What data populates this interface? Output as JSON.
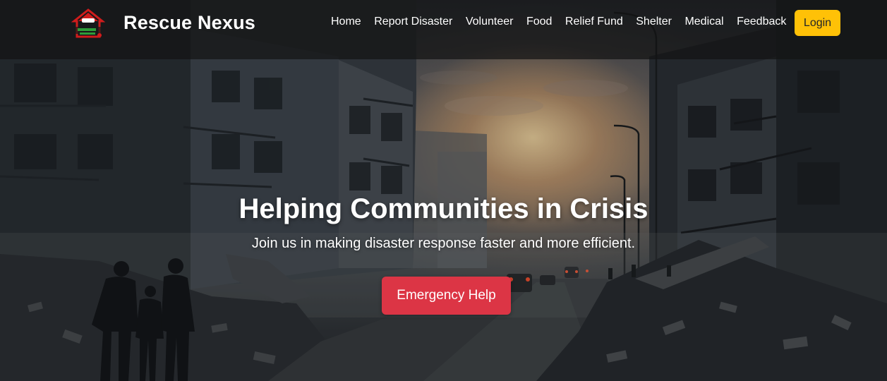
{
  "header": {
    "brand": "Rescue Nexus",
    "logo_icon": "house-shield-icon",
    "nav": [
      {
        "label": "Home"
      },
      {
        "label": "Report Disaster"
      },
      {
        "label": "Volunteer"
      },
      {
        "label": "Food"
      },
      {
        "label": "Relief Fund"
      },
      {
        "label": "Shelter"
      },
      {
        "label": "Medical"
      },
      {
        "label": "Feedback"
      }
    ],
    "login_label": "Login"
  },
  "hero": {
    "title": "Helping Communities in Crisis",
    "subtitle": "Join us in making disaster response faster and more efficient.",
    "cta_label": "Emergency Help",
    "background": "disaster-street-photo"
  },
  "colors": {
    "navbar_bg": "#141414",
    "login_bg": "#ffc107",
    "cta_bg": "#dc3545",
    "text": "#ffffff"
  }
}
